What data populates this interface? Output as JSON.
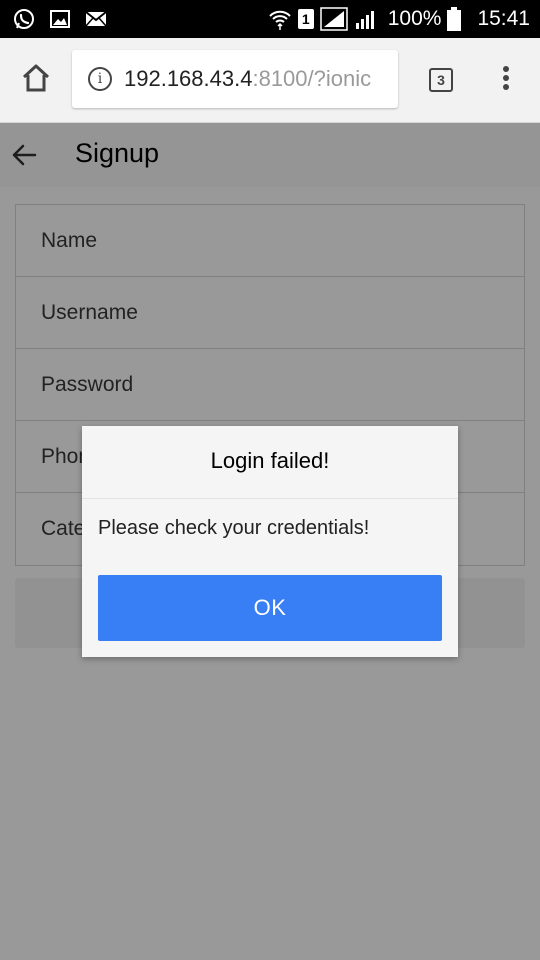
{
  "status_bar": {
    "sim_slot": "1",
    "battery": "100%",
    "time": "15:41",
    "icons": [
      "whatsapp-icon",
      "gallery-icon",
      "email-icon",
      "wifi-icon",
      "signal-icon",
      "signal-icon",
      "battery-icon"
    ]
  },
  "browser": {
    "url_host": "192.168.43.4",
    "url_rest": ":8100/?ionic",
    "tab_count": "3"
  },
  "app": {
    "title": "Signup",
    "fields": [
      {
        "label": "Name"
      },
      {
        "label": "Username"
      },
      {
        "label": "Password"
      },
      {
        "label": "Phone"
      },
      {
        "label": "Category"
      }
    ]
  },
  "alert": {
    "title": "Login failed!",
    "message": "Please check your credentials!",
    "ok_label": "OK",
    "button_color": "#387ef5"
  }
}
